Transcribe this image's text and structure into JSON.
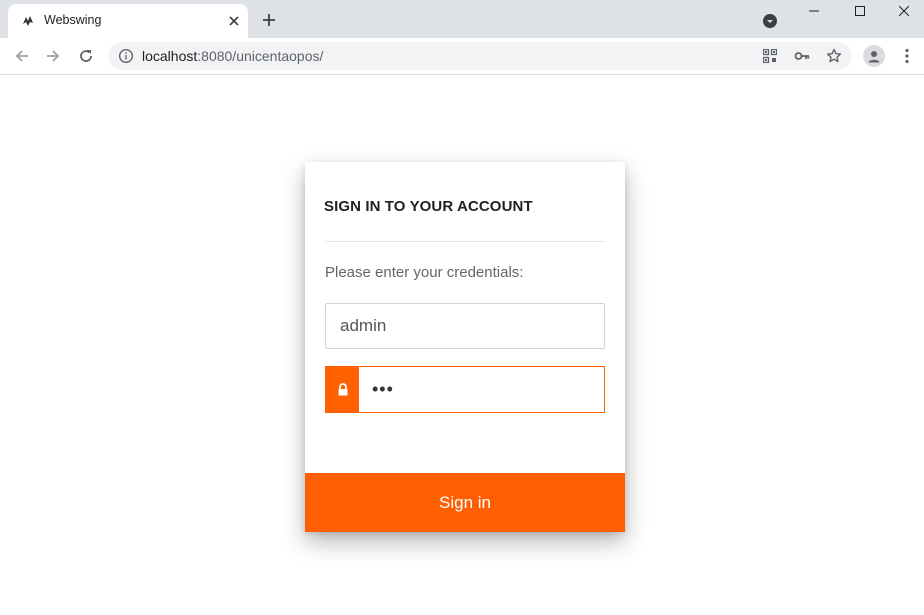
{
  "browser": {
    "tab": {
      "title": "Webswing",
      "favicon": "webswing-logo-icon"
    },
    "url": {
      "host": "localhost",
      "path": ":8080/unicentaopos/"
    },
    "colors": {
      "tabbar": "#dee1e6",
      "omnibox": "#f1f3f4"
    }
  },
  "login": {
    "title": "SIGN IN TO YOUR ACCOUNT",
    "prompt": "Please enter your credentials:",
    "username_value": "admin",
    "password_value": "•••",
    "submit_label": "Sign in",
    "accent_color": "#ff5f00"
  }
}
